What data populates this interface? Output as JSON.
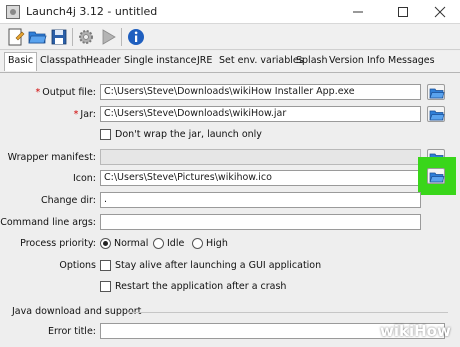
{
  "window": {
    "title": "Launch4j 3.12 - untitled",
    "controls": [
      "minimize",
      "maximize",
      "close"
    ]
  },
  "toolbar": {
    "buttons": [
      {
        "icon": "new-document-icon"
      },
      {
        "icon": "open-folder-icon"
      },
      {
        "icon": "save-icon"
      },
      {
        "icon": "gear-icon"
      },
      {
        "icon": "play-icon"
      },
      {
        "icon": "info-icon"
      }
    ]
  },
  "tabs": [
    "Basic",
    "Classpath",
    "Header",
    "Single instance",
    "JRE",
    "Set env. variables",
    "Splash",
    "Version Info",
    "Messages"
  ],
  "active_tab": "Basic",
  "form": {
    "output_file": {
      "label": "Output file:",
      "value": "C:\\Users\\Steve\\Downloads\\wikiHow Installer App.exe",
      "required": true
    },
    "jar": {
      "label": "Jar:",
      "value": "C:\\Users\\Steve\\Downloads\\wikiHow.jar",
      "required": true
    },
    "dont_wrap": {
      "label": "Don't wrap the jar, launch only",
      "checked": false
    },
    "wrapper_manifest": {
      "label": "Wrapper manifest:",
      "value": ""
    },
    "icon": {
      "label": "Icon:",
      "value": "C:\\Users\\Steve\\Pictures\\wikihow.ico"
    },
    "change_dir": {
      "label": "Change dir:",
      "value": "."
    },
    "command_line_args": {
      "label": "Command line args:",
      "value": ""
    },
    "process_priority": {
      "label": "Process priority:",
      "options": [
        "Normal",
        "Idle",
        "High"
      ],
      "selected": "Normal"
    },
    "options": {
      "label": "Options",
      "stay_alive": {
        "label": "Stay alive after launching a GUI application",
        "checked": false
      },
      "restart": {
        "label": "Restart the application after a crash",
        "checked": false
      }
    }
  },
  "java_download": {
    "section_title": "Java download and support",
    "error_title": {
      "label": "Error title:",
      "value": ""
    }
  },
  "highlight_color": "#39d61a",
  "watermark": {
    "wiki": "wiki",
    "how": "How"
  }
}
